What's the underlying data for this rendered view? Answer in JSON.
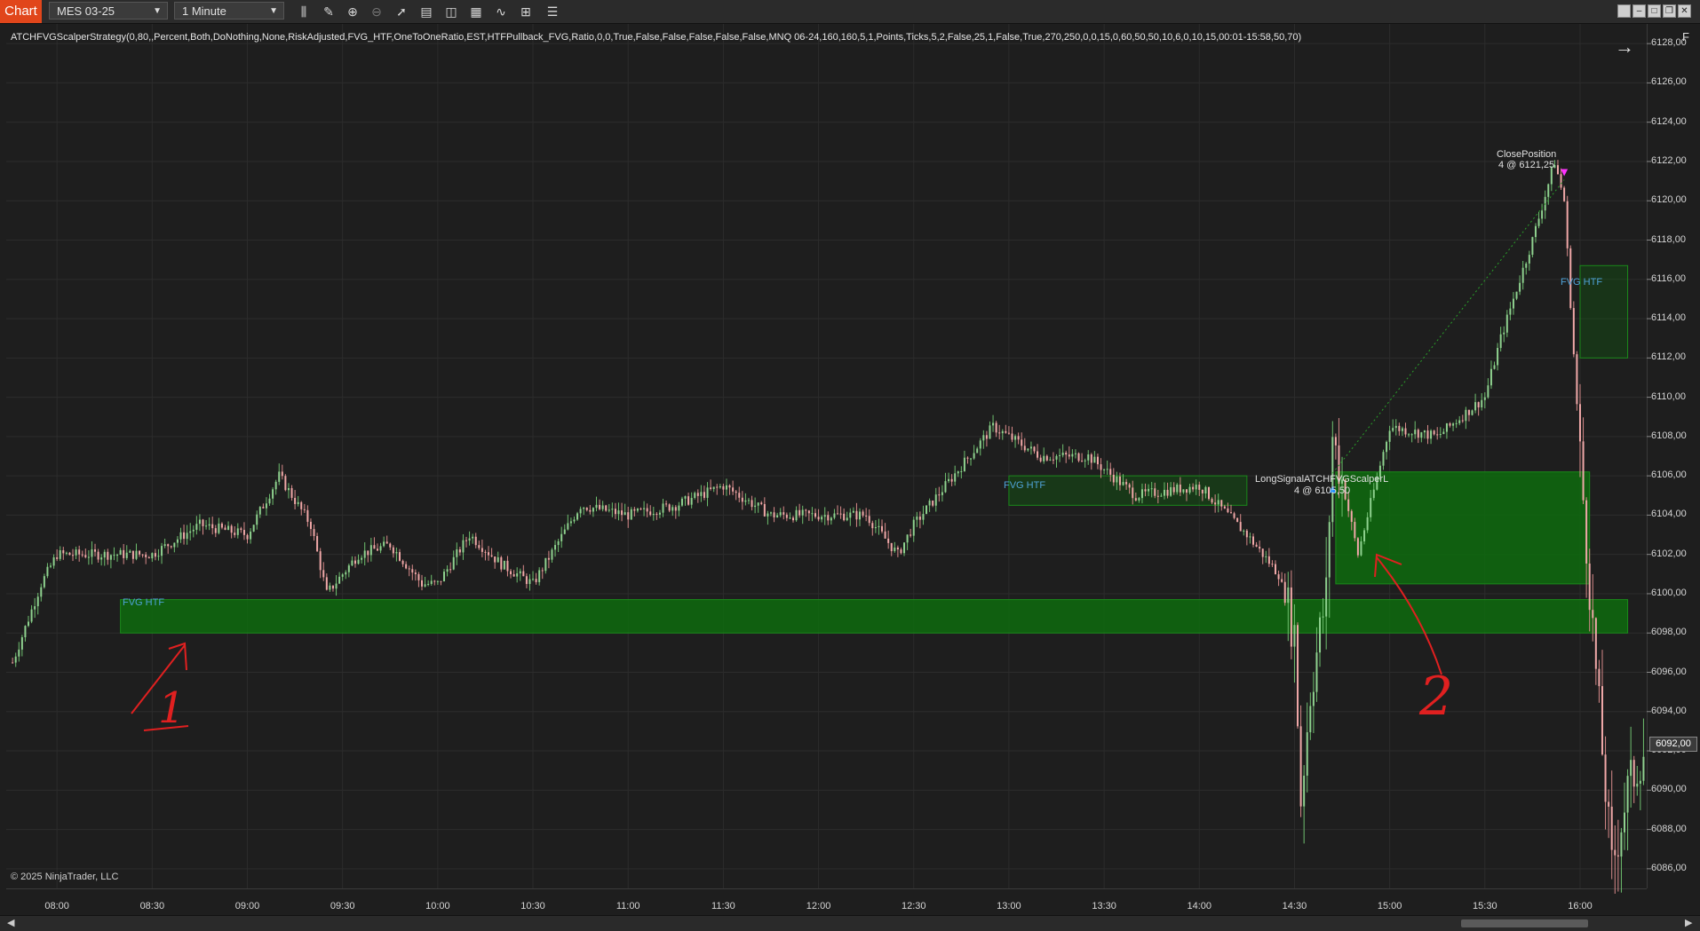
{
  "toolbar": {
    "chart_tab": "Chart",
    "instrument": "MES 03-25",
    "interval": "1 Minute",
    "tools": [
      "bar-type-icon",
      "draw-icon",
      "zoom-in-icon",
      "zoom-out-icon",
      "pointer-icon",
      "data-box-icon",
      "properties-icon",
      "indicators-icon",
      "strategies-icon",
      "templates-icon",
      "menu-icon"
    ]
  },
  "strategy_label": "ATCHFVGScalperStrategy(0,80,,Percent,Both,DoNothing,None,RiskAdjusted,FVG_HTF,OneToOneRatio,EST,HTFPullback_FVG,Ratio,0,0,True,False,False,False,False,False,MNQ 06-24,160,160,5,1,Points,Ticks,5,2,False,25,1,False,True,270,250,0,0,15,0,60,50,50,10,6,0,10,15,00:01-15:58,50,70)",
  "copyright": "© 2025 NinjaTrader, LLC",
  "f_button": "F",
  "colors": {
    "accent": "#e1461b",
    "up_candle": "#8fd18f",
    "down_candle": "#f0a8a8",
    "fvg_fill": "#0e6b0e",
    "annotation": "#e02020",
    "close_marker": "#ff33ff",
    "long_marker": "#1e90ff"
  },
  "price_axis": {
    "labels": [
      "6128,00",
      "6126,00",
      "6124,00",
      "6122,00",
      "6120,00",
      "6118,00",
      "6116,00",
      "6114,00",
      "6112,00",
      "6110,00",
      "6108,00",
      "6106,00",
      "6104,00",
      "6102,00",
      "6100,00",
      "6098,00",
      "6096,00",
      "6094,00",
      "6092,00",
      "6090,00",
      "6088,00",
      "6086,00"
    ],
    "last_price": "6092,00"
  },
  "time_axis": {
    "labels": [
      "08:00",
      "08:30",
      "09:00",
      "09:30",
      "10:00",
      "10:30",
      "11:00",
      "11:30",
      "12:00",
      "12:30",
      "13:00",
      "13:30",
      "14:00",
      "14:30",
      "15:00",
      "15:30",
      "16:00"
    ]
  },
  "annotations": {
    "fvg_htf_1": "FVG HTF",
    "fvg_htf_2": "FVG HTF",
    "fvg_htf_3": "FVG HTF",
    "long_signal": "LongSignalATCHFVGScalperL",
    "long_signal_fill": "4 @ 6105,50",
    "close_position": "ClosePosition",
    "close_fill": "4 @ 6121,25",
    "hand_1": "1",
    "hand_2": "2"
  },
  "chart_data": {
    "type": "candlestick",
    "instrument": "MES 03-25",
    "interval": "1 Minute",
    "ylim": [
      6085,
      6129
    ],
    "x_range": [
      "07:44",
      "16:21"
    ],
    "price_path": [
      [
        "07:46",
        6096.5
      ],
      [
        "07:55",
        6100.5
      ],
      [
        "08:00",
        6102
      ],
      [
        "08:15",
        6102
      ],
      [
        "08:30",
        6102
      ],
      [
        "08:45",
        6103.5
      ],
      [
        "09:00",
        6103
      ],
      [
        "09:10",
        6106
      ],
      [
        "09:20",
        6103.5
      ],
      [
        "09:25",
        6100
      ],
      [
        "09:35",
        6102
      ],
      [
        "09:45",
        6102.5
      ],
      [
        "09:55",
        6100.5
      ],
      [
        "10:00",
        6100.5
      ],
      [
        "10:10",
        6103
      ],
      [
        "10:20",
        6101.5
      ],
      [
        "10:30",
        6100.5
      ],
      [
        "10:45",
        6104.5
      ],
      [
        "11:00",
        6104
      ],
      [
        "11:15",
        6104.5
      ],
      [
        "11:30",
        6105.5
      ],
      [
        "11:45",
        6104
      ],
      [
        "12:00",
        6104
      ],
      [
        "12:15",
        6104
      ],
      [
        "12:25",
        6102
      ],
      [
        "12:30",
        6103.5
      ],
      [
        "12:45",
        6106.5
      ],
      [
        "12:55",
        6108.5
      ],
      [
        "13:10",
        6107
      ],
      [
        "13:25",
        6107
      ],
      [
        "13:40",
        6105
      ],
      [
        "14:00",
        6105.5
      ],
      [
        "14:15",
        6103
      ],
      [
        "14:25",
        6101
      ],
      [
        "14:30",
        6098
      ],
      [
        "14:32",
        6089.5
      ],
      [
        "14:35",
        6095
      ],
      [
        "14:40",
        6100
      ],
      [
        "14:42",
        6108
      ],
      [
        "14:50",
        6102
      ],
      [
        "15:00",
        6108.5
      ],
      [
        "15:15",
        6108
      ],
      [
        "15:30",
        6110
      ],
      [
        "15:35",
        6113
      ],
      [
        "15:45",
        6118
      ],
      [
        "15:52",
        6122
      ],
      [
        "15:55",
        6120
      ],
      [
        "16:00",
        6107
      ],
      [
        "16:05",
        6096
      ],
      [
        "16:10",
        6086
      ],
      [
        "16:15",
        6090
      ],
      [
        "16:20",
        6092
      ]
    ],
    "fvg_zones": [
      {
        "label": "FVG HTF",
        "start": "08:20",
        "end": "16:15",
        "low": 6098,
        "high": 6099.7
      },
      {
        "label": "FVG HTF",
        "start": "13:00",
        "end": "14:15",
        "low": 6104.5,
        "high": 6106
      },
      {
        "label": "FVG HTF",
        "start": "14:43",
        "end": "16:03",
        "low": 6100.5,
        "high": 6106.2
      },
      {
        "label": "FVG HTF",
        "start": "16:00",
        "end": "16:15",
        "low": 6112,
        "high": 6116.7
      }
    ],
    "trades": [
      {
        "label": "LongSignalATCHFVGScalperL",
        "time": "14:42",
        "qty": 4,
        "price": 6105.5
      },
      {
        "label": "ClosePosition",
        "time": "15:55",
        "qty": 4,
        "price": 6121.25
      }
    ]
  }
}
